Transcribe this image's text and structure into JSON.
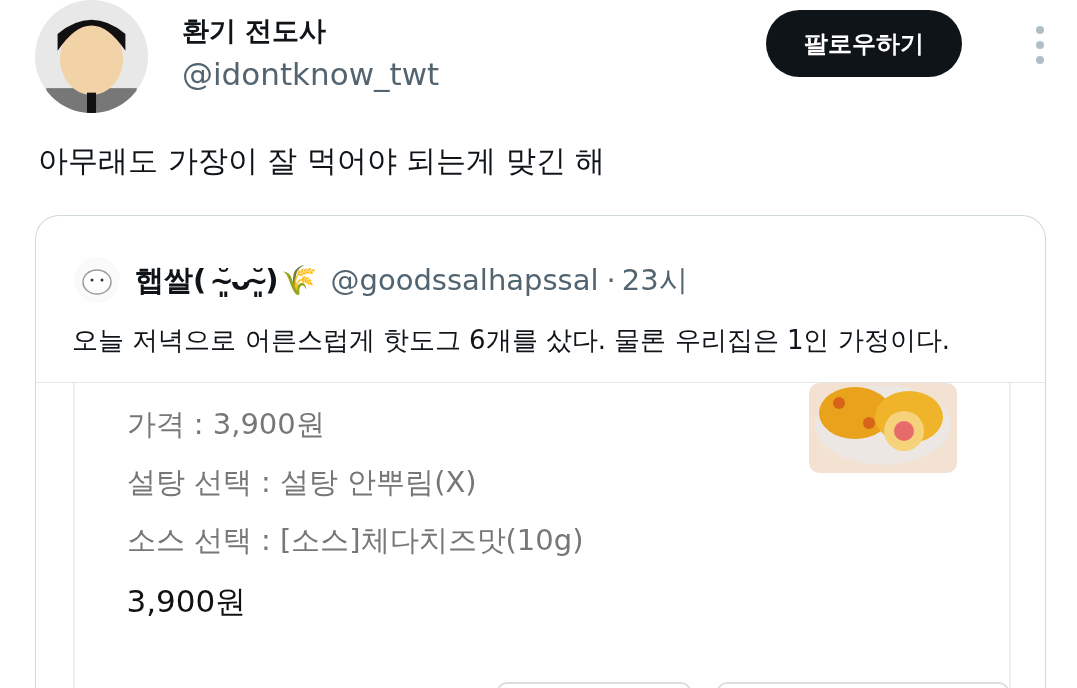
{
  "author": {
    "name": "환기 전도사",
    "handle": "@idontknow_twt"
  },
  "follow_button": "팔로우하기",
  "tweet_text": "아무래도 가장이 잘 먹어야 되는게 맞긴 해",
  "quote": {
    "name": "햅쌀( ˘̴͈ᴗ˘̴͈)",
    "emoji": "🌾",
    "handle": "@goodssalhapssal",
    "separator": "·",
    "time": "23시",
    "text": "오늘 저녁으로 어른스럽게 핫도그 6개를 샀다. 물론 우리집은 1인 가정이다.",
    "media": {
      "options": [
        "가격 : 3,900원",
        "설탕 선택 : 설탕 안뿌림(X)",
        "소스 선택 : [소스]체다치즈맛(10g)"
      ],
      "total": "3,900원"
    }
  }
}
